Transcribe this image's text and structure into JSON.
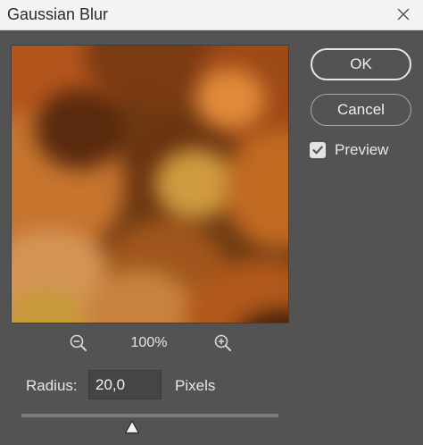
{
  "window": {
    "title": "Gaussian Blur"
  },
  "buttons": {
    "ok_label": "OK",
    "cancel_label": "Cancel"
  },
  "preview_toggle": {
    "label": "Preview",
    "checked": true
  },
  "zoom": {
    "level": "100%"
  },
  "radius": {
    "label": "Radius:",
    "value": "20,0",
    "unit_label": "Pixels"
  },
  "slider": {
    "fraction": 0.43
  },
  "icons": {
    "close": "close-icon",
    "zoom_out": "zoom-out-icon",
    "zoom_in": "zoom-in-icon",
    "check": "checkmark-icon",
    "slider_thumb": "triangle-thumb-icon"
  },
  "colors": {
    "dialog_bg": "#535353",
    "titlebar_bg": "#f3f3f3",
    "text": "#e6e6e6",
    "input_bg": "#454545"
  }
}
